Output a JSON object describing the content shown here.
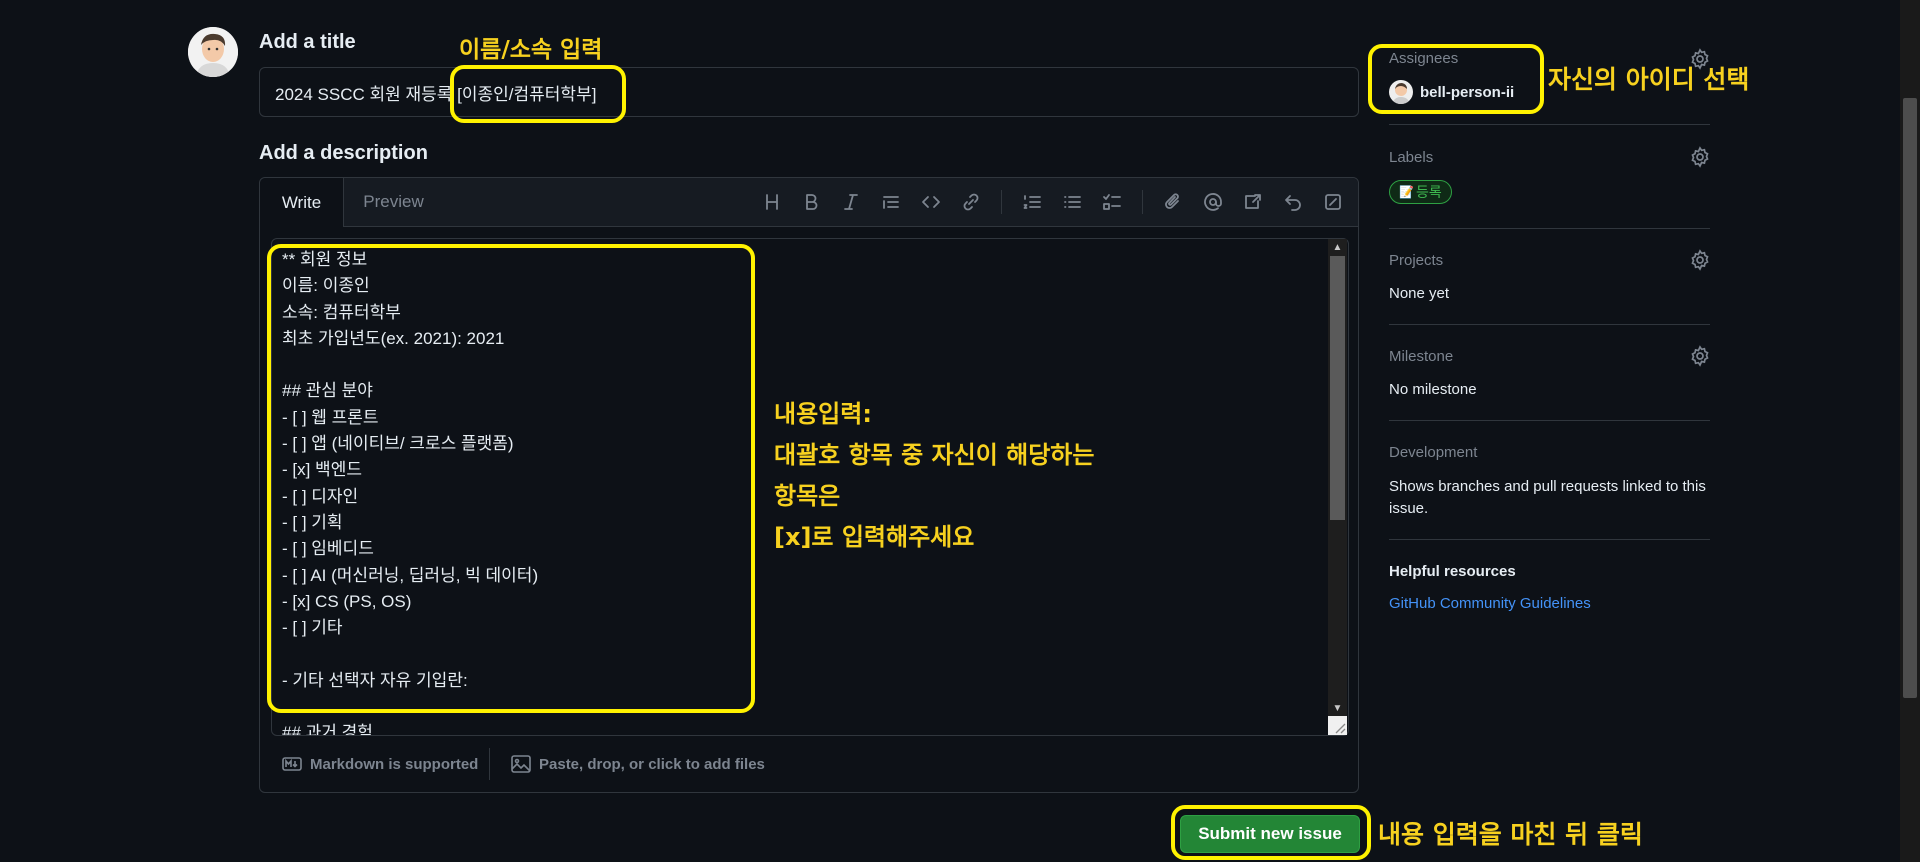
{
  "title_section": {
    "heading": "Add a title",
    "value": "2024 SSCC 회원 재등록 [이종인/컴퓨터학부]"
  },
  "description_section": {
    "heading": "Add a description",
    "tabs": [
      "Write",
      "Preview"
    ],
    "toolbar_icons": [
      "heading-icon",
      "bold-icon",
      "italic-icon",
      "quote-icon",
      "code-icon",
      "link-icon",
      "numbered-list-icon",
      "unordered-list-icon",
      "task-list-icon",
      "attach-icon",
      "mention-icon",
      "reference-icon",
      "undo-icon",
      "fullscreen-icon"
    ],
    "body_lines": [
      "** 회원 정보",
      "이름: 이종인",
      "소속: 컴퓨터학부",
      "최초 가입년도(ex. 2021): 2021",
      "",
      "## 관심 분야",
      "- [ ] 웹 프론트",
      "- [ ] 앱 (네이티브/ 크로스 플랫폼)",
      "- [x] 백엔드",
      "- [ ] 디자인",
      "- [ ] 기획",
      "- [ ] 임베디드",
      "- [ ] AI (머신러닝, 딥러닝, 빅 데이터)",
      "- [x] CS (PS, OS)",
      "- [ ] 기타",
      "",
      "- 기타 선택자 자유 기입란:",
      "",
      "## 과거 경험"
    ],
    "footer_markdown": "Markdown is supported",
    "footer_attach": "Paste, drop, or click to add files"
  },
  "submit_label": "Submit new issue",
  "sidebar": {
    "assignees": {
      "label": "Assignees",
      "user": "bell-person-ii"
    },
    "labels": {
      "label": "Labels",
      "badge": "등록"
    },
    "projects": {
      "label": "Projects",
      "value": "None yet"
    },
    "milestone": {
      "label": "Milestone",
      "value": "No milestone"
    },
    "development": {
      "label": "Development",
      "value": "Shows branches and pull requests linked to this issue."
    },
    "helpful": {
      "label": "Helpful resources",
      "link": "GitHub Community Guidelines"
    }
  },
  "annotations": {
    "name_input": "이름/소속 입력",
    "select_id": "자신의 아이디 선택",
    "content_1": "내용입력:",
    "content_2": "대괄호 항목 중 자신이 해당하는",
    "content_3": "항목은",
    "content_4": "[x]로 입력해주세요",
    "submit_note": "내용 입력을 마친 뒤 클릭"
  },
  "colors": {
    "background": "#0d1117",
    "accent_green": "#238636",
    "highlight": "#fff200",
    "note_text": "#f7d11f",
    "link": "#4493f8"
  }
}
